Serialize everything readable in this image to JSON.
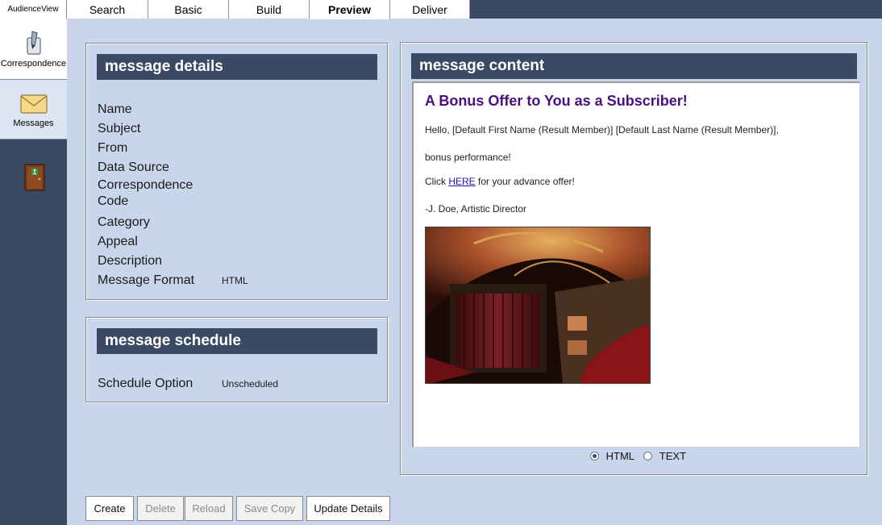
{
  "app": {
    "brand": "AudienceView"
  },
  "sidebar": {
    "items": [
      {
        "label": "Correspondence",
        "icon": "quill-icon"
      },
      {
        "label": "Messages",
        "icon": "envelope-icon"
      },
      {
        "label": "",
        "icon": "exit-door-icon"
      }
    ]
  },
  "tabs": [
    {
      "label": "Search"
    },
    {
      "label": "Basic"
    },
    {
      "label": "Build"
    },
    {
      "label": "Preview",
      "active": true
    },
    {
      "label": "Deliver"
    }
  ],
  "details": {
    "title": "message details",
    "fields": [
      {
        "label": "Name",
        "value": ""
      },
      {
        "label": "Subject",
        "value": ""
      },
      {
        "label": "From",
        "value": ""
      },
      {
        "label": "Data Source",
        "value": ""
      },
      {
        "label": "Correspondence Code",
        "value": ""
      },
      {
        "label": "Category",
        "value": ""
      },
      {
        "label": "Appeal",
        "value": ""
      },
      {
        "label": "Description",
        "value": ""
      },
      {
        "label": "Message Format",
        "value": "HTML"
      }
    ]
  },
  "schedule": {
    "title": "message schedule",
    "fields": [
      {
        "label": "Schedule Option",
        "value": "Unscheduled"
      }
    ]
  },
  "content": {
    "title": "message content",
    "heading": "A Bonus Offer to You as a Subscriber!",
    "greeting": "Hello, [Default First Name (Result Member)] [Default Last Name (Result Member)],",
    "body": "bonus performance!",
    "click_prefix": "Click ",
    "click_link": "HERE",
    "click_suffix": " for your advance offer!",
    "signature": "-J. Doe, Artistic Director",
    "format_options": [
      {
        "label": "HTML",
        "selected": true
      },
      {
        "label": "TEXT",
        "selected": false
      }
    ]
  },
  "buttons": [
    {
      "label": "Create",
      "enabled": true
    },
    {
      "label": "Delete",
      "enabled": false
    },
    {
      "label": "Reload",
      "enabled": false
    },
    {
      "label": "Save Copy",
      "enabled": false
    },
    {
      "label": "Update Details",
      "enabled": true
    }
  ],
  "colors": {
    "background": "#c9d5eb",
    "header_navy": "#3a4964",
    "heading_purple": "#4b1080"
  }
}
